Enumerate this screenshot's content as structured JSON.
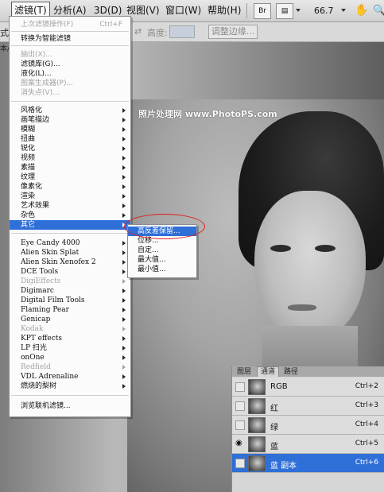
{
  "menubar": {
    "items": [
      "滤镜(T)",
      "分析(A)",
      "3D(D)",
      "视图(V)",
      "窗口(W)",
      "帮助(H)"
    ],
    "br_label": "Br",
    "zoom": "66.7"
  },
  "options": {
    "label_left": "式:",
    "label_left2": "本/",
    "height_label": "高度:",
    "refine_button": "调整边缘..."
  },
  "filter_menu": {
    "items": [
      {
        "label": "上次滤镜操作(F)",
        "shortcut": "Ctrl+F",
        "disabled": true
      },
      {
        "label": "转换为智能滤镜"
      },
      {
        "label": "抽出(X)...",
        "disabled": true
      },
      {
        "label": "滤镜库(G)..."
      },
      {
        "label": "液化(L)..."
      },
      {
        "label": "图案生成器(P)...",
        "disabled": true
      },
      {
        "label": "消失点(V)...",
        "disabled": true
      },
      {
        "label": "风格化",
        "submenu": true
      },
      {
        "label": "画笔描边",
        "submenu": true
      },
      {
        "label": "模糊",
        "submenu": true
      },
      {
        "label": "扭曲",
        "submenu": true
      },
      {
        "label": "锐化",
        "submenu": true
      },
      {
        "label": "视频",
        "submenu": true
      },
      {
        "label": "素描",
        "submenu": true
      },
      {
        "label": "纹理",
        "submenu": true
      },
      {
        "label": "像素化",
        "submenu": true
      },
      {
        "label": "渲染",
        "submenu": true
      },
      {
        "label": "艺术效果",
        "submenu": true
      },
      {
        "label": "杂色",
        "submenu": true
      },
      {
        "label": "其它",
        "submenu": true,
        "highlighted": true
      },
      {
        "label": "Eye Candy 4000",
        "submenu": true
      },
      {
        "label": "Alien Skin Splat",
        "submenu": true
      },
      {
        "label": "Alien Skin Xenofex 2",
        "submenu": true
      },
      {
        "label": "DCE Tools",
        "submenu": true
      },
      {
        "label": "DigiEffects",
        "submenu": true,
        "disabled": true
      },
      {
        "label": "Digimarc",
        "submenu": true
      },
      {
        "label": "Digital Film Tools",
        "submenu": true
      },
      {
        "label": "Flaming Pear",
        "submenu": true
      },
      {
        "label": "Genicap",
        "submenu": true
      },
      {
        "label": "Kodak",
        "submenu": true,
        "disabled": true
      },
      {
        "label": "KPT effects",
        "submenu": true
      },
      {
        "label": "LP 扫光",
        "submenu": true
      },
      {
        "label": "onOne",
        "submenu": true
      },
      {
        "label": "Redfield",
        "submenu": true,
        "disabled": true
      },
      {
        "label": "VDL Adrenaline",
        "submenu": true
      },
      {
        "label": "燃烧的梨树",
        "submenu": true
      },
      {
        "label": "浏览联机滤镜..."
      }
    ]
  },
  "submenu": {
    "items": [
      "高反差保留...",
      "位移...",
      "自定...",
      "最大值...",
      "最小值..."
    ]
  },
  "watermark": "照片处理网 www.PhotoPS.com",
  "channels_panel": {
    "tabs": [
      "图层",
      "通道",
      "路径"
    ],
    "rows": [
      {
        "name": "RGB",
        "shortcut": "Ctrl+2",
        "visible": false,
        "selected": false
      },
      {
        "name": "红",
        "shortcut": "Ctrl+3",
        "visible": false,
        "selected": false
      },
      {
        "name": "绿",
        "shortcut": "Ctrl+4",
        "visible": false,
        "selected": false
      },
      {
        "name": "蓝",
        "shortcut": "Ctrl+5",
        "visible": true,
        "selected": false
      },
      {
        "name": "蓝 副本",
        "shortcut": "Ctrl+6",
        "visible": false,
        "selected": true
      }
    ]
  },
  "colors": {
    "highlight": "#2f6fd8",
    "annotation": "#e02020"
  }
}
